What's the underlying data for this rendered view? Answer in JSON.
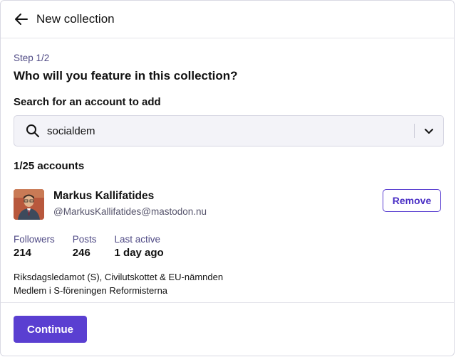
{
  "header": {
    "title": "New collection",
    "back_icon": "arrow-left-icon"
  },
  "step": "Step 1/2",
  "question": "Who will you feature in this collection?",
  "search": {
    "label": "Search for an account to add",
    "value": "socialdem",
    "icon": "search-icon",
    "dropdown_icon": "chevron-down-icon"
  },
  "count": "1/25 accounts",
  "account": {
    "name": "Markus Kallifatides",
    "handle": "@MarkusKallifatides@mastodon.nu",
    "remove_label": "Remove",
    "stats": [
      {
        "label": "Followers",
        "value": "214"
      },
      {
        "label": "Posts",
        "value": "246"
      },
      {
        "label": "Last active",
        "value": "1 day ago"
      }
    ],
    "bio_lines": [
      "Riksdagsledamot (S), Civilutskottet & EU-nämnden",
      "Medlem i S-föreningen Reformisterna"
    ]
  },
  "footer": {
    "continue_label": "Continue"
  },
  "colors": {
    "accent": "#5a3fd1",
    "muted_label": "#4f4a85",
    "search_bg": "#f3f3f8"
  }
}
